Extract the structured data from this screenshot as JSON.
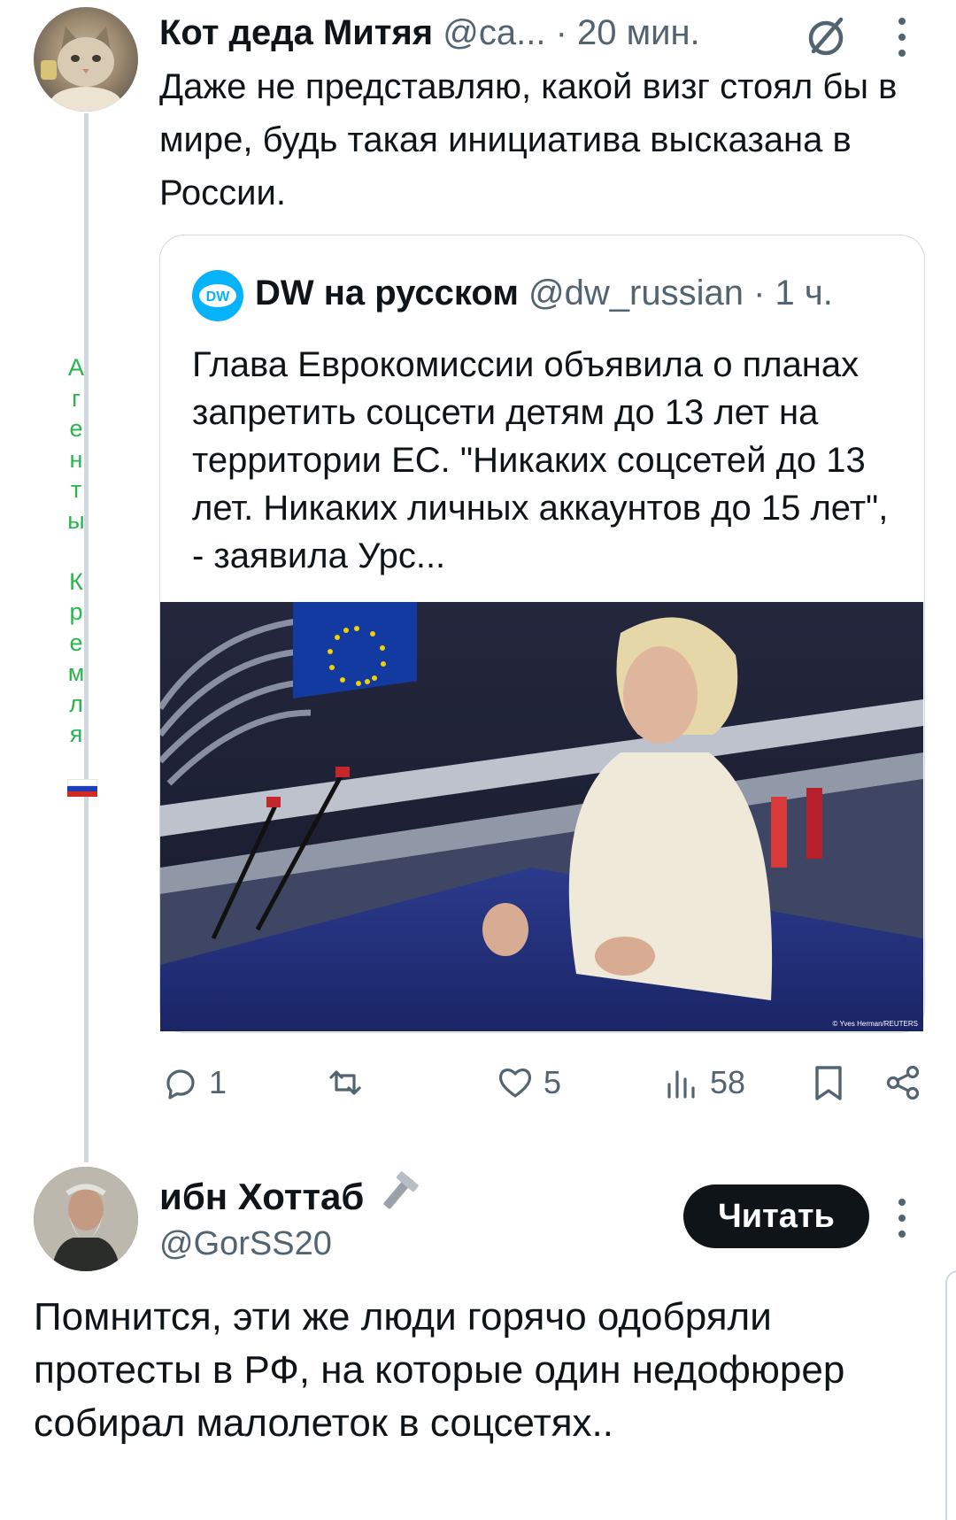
{
  "tweet1": {
    "author_name": "Кот деда Митяя",
    "handle": "@ca...",
    "separator": " · ",
    "time": "20 мин.",
    "text": "Даже не представляю, какой визг стоял бы в мире, будь такая инициатива высказана в России.",
    "side_caption": [
      "А",
      "г",
      "е",
      "н",
      "т",
      "ы",
      "",
      "К",
      "р",
      "е",
      "м",
      "л",
      "я"
    ],
    "quote": {
      "logo_text": "DW",
      "author_name": "DW на русском",
      "handle": "@dw_russian",
      "separator": " · ",
      "time": "1 ч.",
      "text": "Глава Еврокомиссии объявила о планах запретить соцсети детям до 13 лет на территории ЕС. \"Никаких соцсетей до 13 лет. Никаких личных аккаунтов до 15 лет\", - заявила Урс...",
      "image_credit": "© Yves Herman/REUTERS"
    },
    "actions": {
      "replies": "1",
      "reposts": "",
      "likes": "5",
      "views": "58"
    }
  },
  "tweet2": {
    "author_name": "ибн Хоттаб",
    "handle": "@GorSS20",
    "follow_label": "Читать",
    "text": "Помнится, эти же люди горячо одобряли протесты в РФ, на которые один недофюрер собирал малолеток в соцсетях.."
  },
  "colors": {
    "text": "#0f1419",
    "muted": "#536471",
    "border": "#cfd9de",
    "side_caption": "#27b64a",
    "dw_blue": "#05b2fc"
  },
  "icons": [
    "grok-icon",
    "more-vertical-icon",
    "reply-icon",
    "repost-icon",
    "like-icon",
    "views-icon",
    "bookmark-icon",
    "share-icon",
    "tool-emoji-icon",
    "flag-icon"
  ]
}
